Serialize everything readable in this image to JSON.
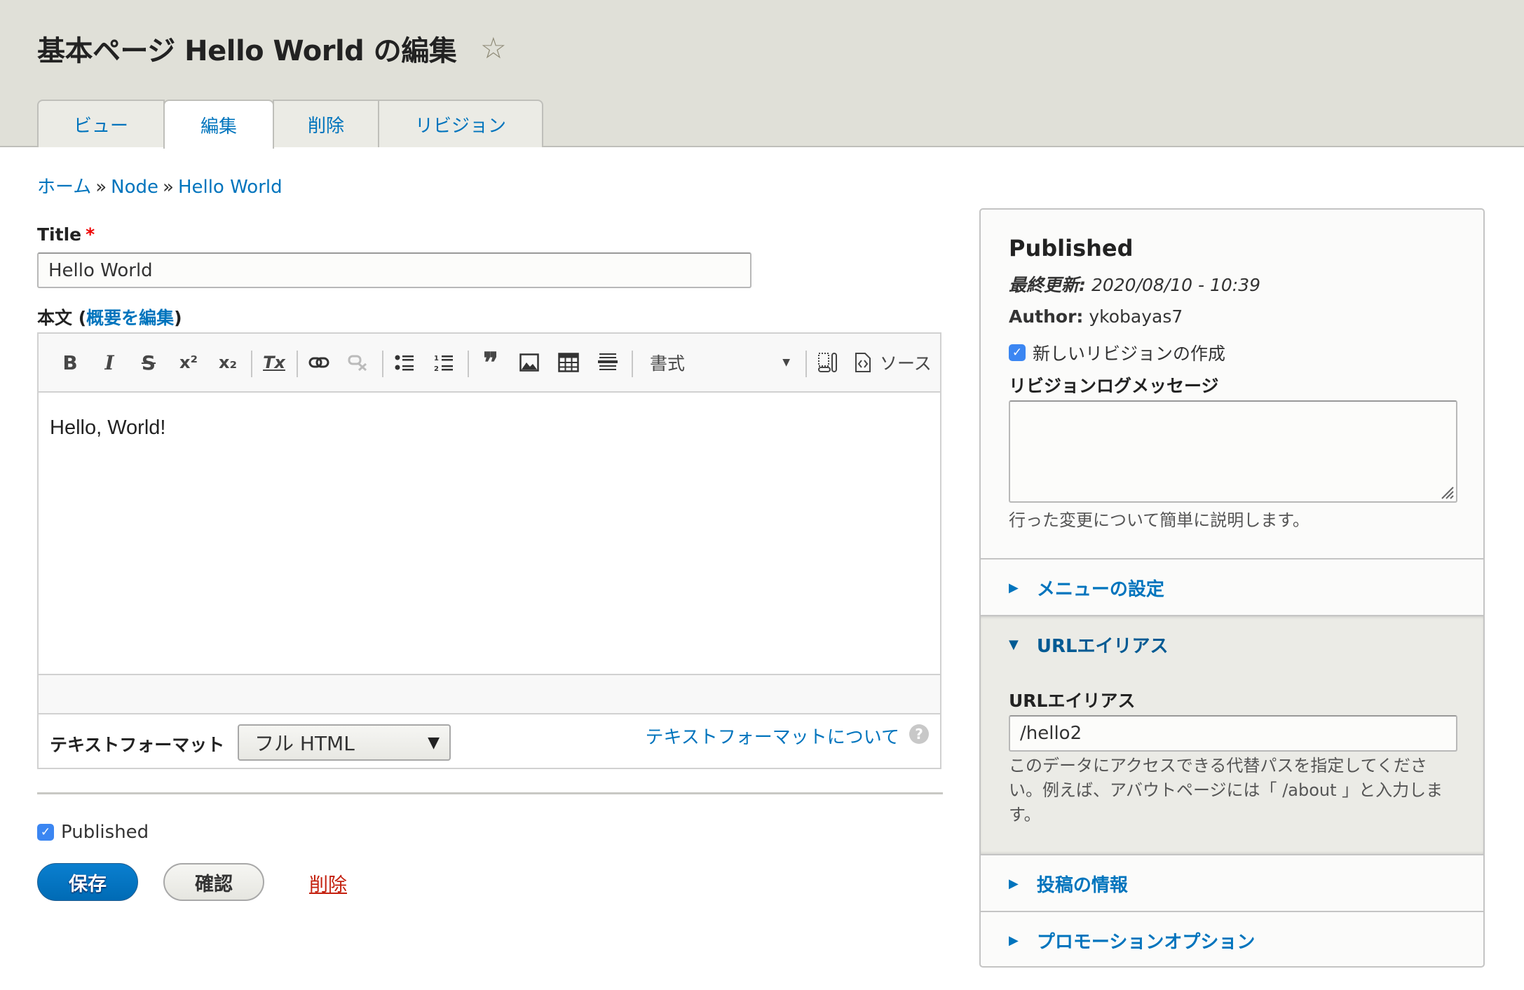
{
  "header": {
    "title": "基本ページ Hello World の編集",
    "star_icon": "☆",
    "tabs": [
      {
        "label": "ビュー",
        "active": false
      },
      {
        "label": "編集",
        "active": true
      },
      {
        "label": "削除",
        "active": false
      },
      {
        "label": "リビジョン",
        "active": false
      }
    ]
  },
  "breadcrumb": {
    "items": [
      "ホーム",
      "Node",
      "Hello World"
    ],
    "separator": "»"
  },
  "form": {
    "title_label": "Title",
    "required_marker": "*",
    "title_value": "Hello World",
    "body_label": "本文 (",
    "body_summary_link": "概要を編集",
    "body_label_close": ")",
    "editor": {
      "toolbar": {
        "bold": "B",
        "italic": "I",
        "strike": "S",
        "superscript": "x²",
        "subscript": "x₂",
        "remove_format": "Tx",
        "link": "link-icon",
        "unlink": "unlink-icon",
        "bulleted_list": "bulleted-list-icon",
        "numbered_list": "numbered-list-icon",
        "blockquote": "❞",
        "image": "image-icon",
        "table": "table-icon",
        "horizontal_line": "horizontal-line-icon",
        "format_label": "書式",
        "show_blocks": "show-blocks-icon",
        "source_label": "ソース"
      },
      "content": "Hello, World!"
    },
    "text_format": {
      "label": "テキストフォーマット",
      "selected": "フル HTML",
      "help_link": "テキストフォーマットについて",
      "help_icon": "?"
    },
    "published": {
      "label": "Published",
      "checked": true
    },
    "actions": {
      "save": "保存",
      "preview": "確認",
      "delete": "削除"
    }
  },
  "sidebar": {
    "status": "Published",
    "last_updated_label": "最終更新:",
    "last_updated_value": "2020/08/10 - 10:39",
    "author_label": "Author:",
    "author_value": "ykobayas7",
    "new_revision": {
      "label": "新しいリビジョンの作成",
      "checked": true
    },
    "revision_log_label": "リビジョンログメッセージ",
    "revision_log_value": "",
    "revision_log_desc": "行った変更について簡単に説明します。",
    "sections": [
      {
        "label": "メニューの設定",
        "expanded": false
      },
      {
        "label": "URLエイリアス",
        "expanded": true
      },
      {
        "label": "投稿の情報",
        "expanded": false
      },
      {
        "label": "プロモーションオプション",
        "expanded": false
      }
    ],
    "url_alias": {
      "label": "URLエイリアス",
      "value": "/hello2",
      "description": "このデータにアクセスできる代替パスを指定してください。例えば、アバウトページには「 /about 」と入力します。"
    }
  },
  "colors": {
    "link": "#0074bd",
    "primary_button": "#0074bd",
    "danger": "#c4200e",
    "required": "#e00000",
    "header_bg": "#e0e0d8"
  }
}
